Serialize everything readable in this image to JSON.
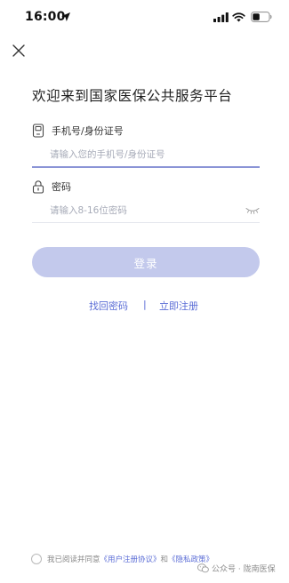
{
  "status_bar": {
    "time": "16:00"
  },
  "header": {
    "title": "欢迎来到国家医保公共服务平台"
  },
  "form": {
    "phone": {
      "label": "手机号/身份证号",
      "placeholder": "请输入您的手机号/身份证号",
      "value": ""
    },
    "password": {
      "label": "密码",
      "placeholder": "请输入8-16位密码",
      "value": ""
    },
    "login_label": "登录"
  },
  "links": {
    "forgot": "找回密码",
    "divider": "|",
    "register": "立即注册"
  },
  "agreement": {
    "prefix": "我已阅读并同意",
    "user_agreement": "《用户注册协议》",
    "conjunction": "和",
    "privacy_policy": "《隐私政策》"
  },
  "watermark": {
    "text": "公众号 · 陇南医保"
  },
  "colors": {
    "accent": "#5b6dd6",
    "button_disabled": "#c3c9ec",
    "focused_underline": "#8a94d6"
  },
  "icons": {
    "location": "location-arrow-icon",
    "signal": "cellular-signal-icon",
    "wifi": "wifi-icon",
    "battery": "battery-icon",
    "close": "close-icon",
    "phone": "phone-icon",
    "lock": "lock-icon",
    "eye": "eye-closed-icon",
    "wechat": "wechat-logo-icon"
  }
}
